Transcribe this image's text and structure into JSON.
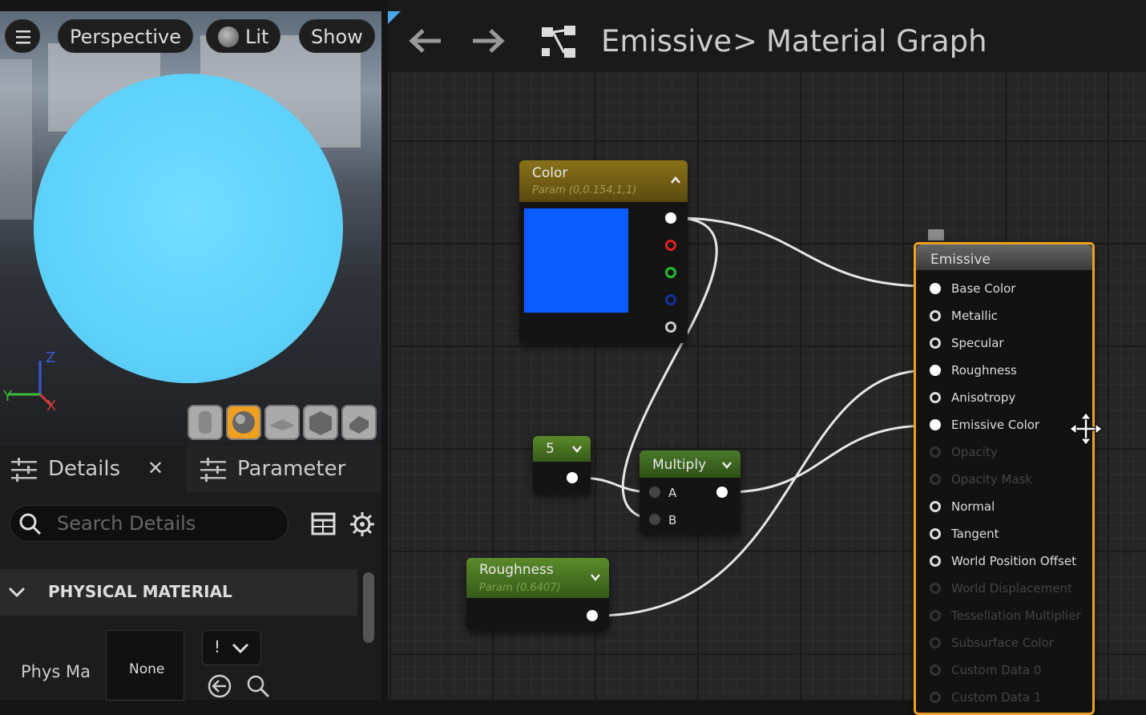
{
  "viewport": {
    "perspective_label": "Perspective",
    "lit_label": "Lit",
    "show_label": "Show",
    "axis_labels": {
      "z": "Z",
      "y": "Y",
      "x": "X"
    }
  },
  "details": {
    "tab_details_label": "Details",
    "tab_parameters_label": "Parameter",
    "search_placeholder": "Search Details",
    "section_title": "PHYSICAL MATERIAL",
    "phys_mat_label": "Phys Ma",
    "phys_mat_value": "None",
    "dropdown_value": "!"
  },
  "graph": {
    "breadcrumb_asset": "Emissive",
    "breadcrumb_separator": ">",
    "breadcrumb_graph": "Material Graph",
    "color_node": {
      "title": "Color",
      "subtitle": "Param (0,0.154,1,1)",
      "swatch_color": "#0a5cff"
    },
    "constant_node": {
      "value": "5"
    },
    "multiply_node": {
      "title": "Multiply",
      "pin_a": "A",
      "pin_b": "B"
    },
    "roughness_node": {
      "title": "Roughness",
      "subtitle": "Param (0.6407)"
    },
    "result_node": {
      "title": "Emissive",
      "pins": [
        {
          "label": "Base Color",
          "state": "connected"
        },
        {
          "label": "Metallic",
          "state": "open"
        },
        {
          "label": "Specular",
          "state": "open"
        },
        {
          "label": "Roughness",
          "state": "connected"
        },
        {
          "label": "Anisotropy",
          "state": "open"
        },
        {
          "label": "Emissive Color",
          "state": "connected"
        },
        {
          "label": "Opacity",
          "state": "disabled"
        },
        {
          "label": "Opacity Mask",
          "state": "disabled"
        },
        {
          "label": "Normal",
          "state": "open"
        },
        {
          "label": "Tangent",
          "state": "open"
        },
        {
          "label": "World Position Offset",
          "state": "open"
        },
        {
          "label": "World Displacement",
          "state": "disabled"
        },
        {
          "label": "Tessellation Multiplier",
          "state": "disabled"
        },
        {
          "label": "Subsurface Color",
          "state": "disabled"
        },
        {
          "label": "Custom Data 0",
          "state": "disabled"
        },
        {
          "label": "Custom Data 1",
          "state": "disabled"
        }
      ]
    }
  },
  "colors": {
    "accent_orange": "#f0a020",
    "param_header": "#6e5a14",
    "math_header": "#3e6a22"
  }
}
